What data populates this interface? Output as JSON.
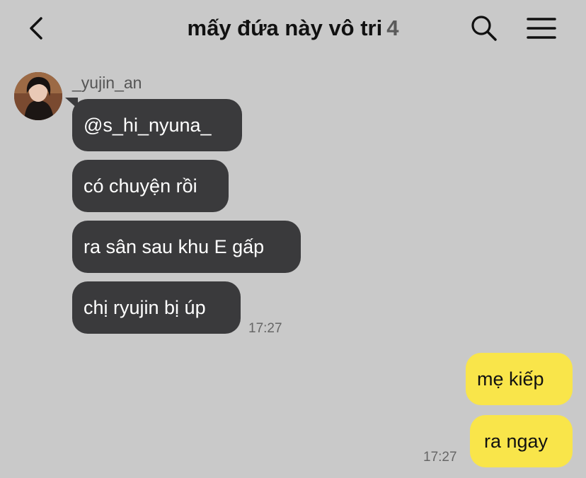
{
  "header": {
    "title": "mấy đứa này vô tri",
    "member_count": "4"
  },
  "icons": {
    "back": "chevron-left-icon",
    "search": "search-icon",
    "menu": "hamburger-menu-icon"
  },
  "colors": {
    "background": "#c9c9c9",
    "incoming_bubble": "#3a3a3c",
    "outgoing_bubble": "#f9e54a"
  },
  "messages": {
    "incoming": {
      "sender": "_yujin_an",
      "items": [
        {
          "text": "@s_hi_nyuna_"
        },
        {
          "text": "có chuyện rồi"
        },
        {
          "text": "ra sân sau khu E gấp"
        },
        {
          "text": "chị ryujin bị úp"
        }
      ],
      "time": "17:27"
    },
    "outgoing": {
      "items": [
        {
          "text": "mẹ kiếp"
        },
        {
          "text": "ra ngay"
        }
      ],
      "time": "17:27"
    }
  }
}
